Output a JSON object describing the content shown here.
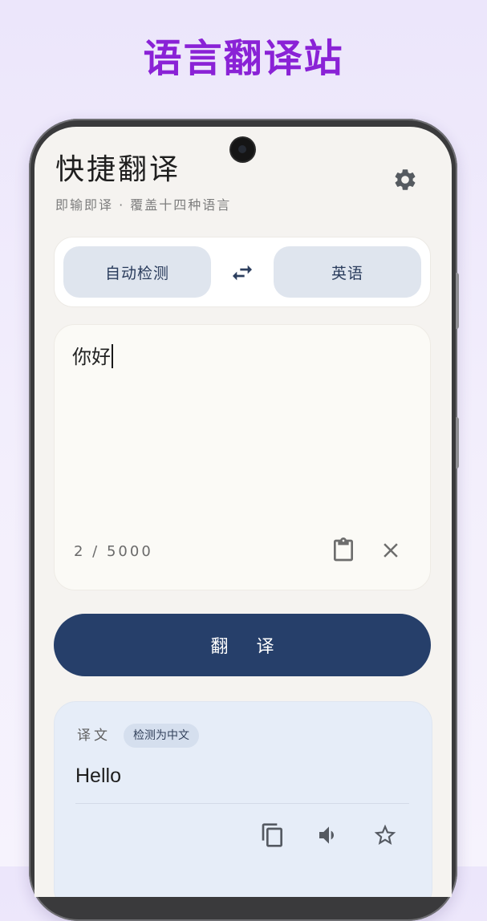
{
  "promo": {
    "title": "语言翻译站"
  },
  "header": {
    "title": "快捷翻译",
    "subtitle": "即输即译 · 覆盖十四种语言",
    "settings_icon": "gear-icon"
  },
  "language_bar": {
    "source": "自动检测",
    "target": "英语",
    "swap_icon": "swap-arrows-icon"
  },
  "input": {
    "text": "你好",
    "char_count": "2 / 5000",
    "paste_icon": "clipboard-icon",
    "clear_icon": "close-icon"
  },
  "actions": {
    "translate_label": "翻 译"
  },
  "result": {
    "label": "译文",
    "detected_badge": "检测为中文",
    "text": "Hello",
    "icons": [
      "copy-icon",
      "speaker-icon",
      "star-icon"
    ]
  },
  "colors": {
    "accent_purple": "#8a22d6",
    "primary_navy": "#263f6a",
    "result_bg": "#e6edf8",
    "lang_chip_bg": "#dfe5ee"
  }
}
